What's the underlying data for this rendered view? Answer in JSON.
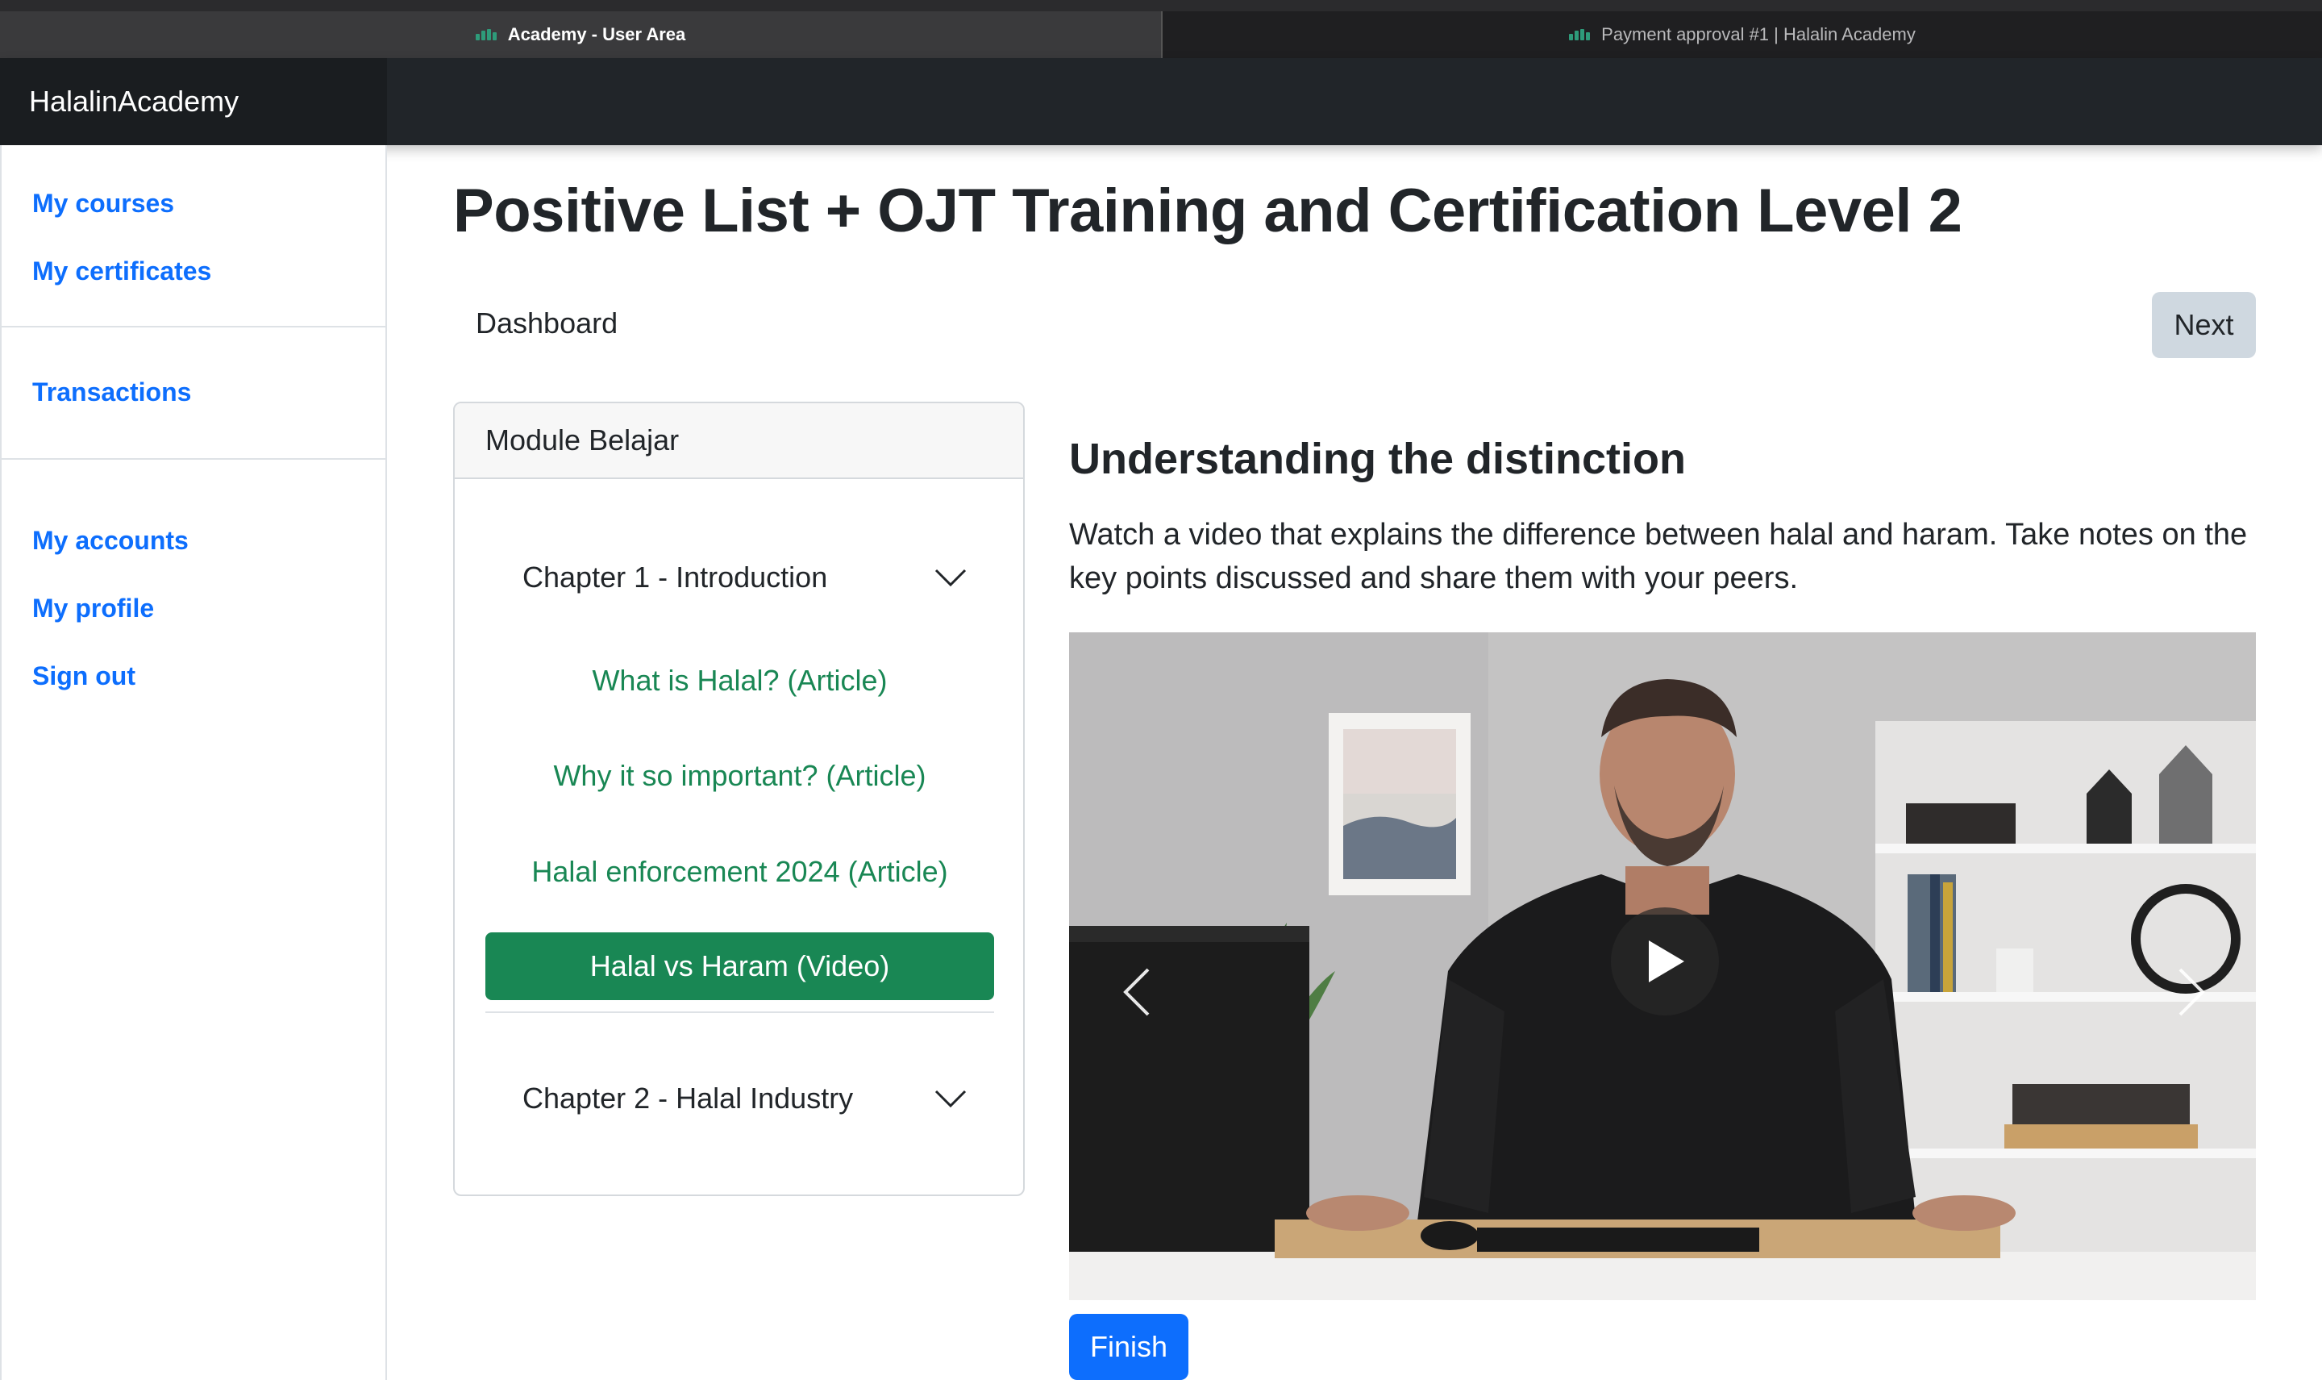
{
  "browser": {
    "tabs": [
      {
        "label": "Academy - User Area",
        "active": true
      },
      {
        "label": "Payment approval #1 | Halalin Academy",
        "active": false
      }
    ]
  },
  "header": {
    "brand": "HalalinAcademy"
  },
  "sidebar": {
    "groups": [
      [
        "My courses",
        "My certificates"
      ],
      [
        "Transactions"
      ],
      [
        "My accounts",
        "My profile",
        "Sign out"
      ]
    ],
    "link_color": "#0d6efd"
  },
  "page": {
    "title": "Positive List + OJT Training and Certification Level 2",
    "breadcrumb": "Dashboard",
    "next_label": "Next"
  },
  "module": {
    "header": "Module Belajar",
    "chapters": [
      {
        "label": "Chapter 1 - Introduction",
        "expanded": true,
        "lessons": [
          {
            "label": "What is Halal? (Article)",
            "active": false
          },
          {
            "label": "Why it so important? (Article)",
            "active": false
          },
          {
            "label": "Halal enforcement 2024 (Article)",
            "active": false
          },
          {
            "label": "Halal vs Haram (Video)",
            "active": true
          }
        ]
      },
      {
        "label": "Chapter 2 - Halal Industry",
        "expanded": false,
        "lessons": []
      }
    ],
    "accent": "#198754"
  },
  "content": {
    "title": "Understanding the distinction",
    "description": "Watch a video that explains the difference between halal and haram. Take notes on the key points discussed and share them with your peers.",
    "video": {
      "controls": [
        "play-icon",
        "chevron-left-icon",
        "chevron-right-icon"
      ]
    },
    "finish_label": "Finish"
  }
}
